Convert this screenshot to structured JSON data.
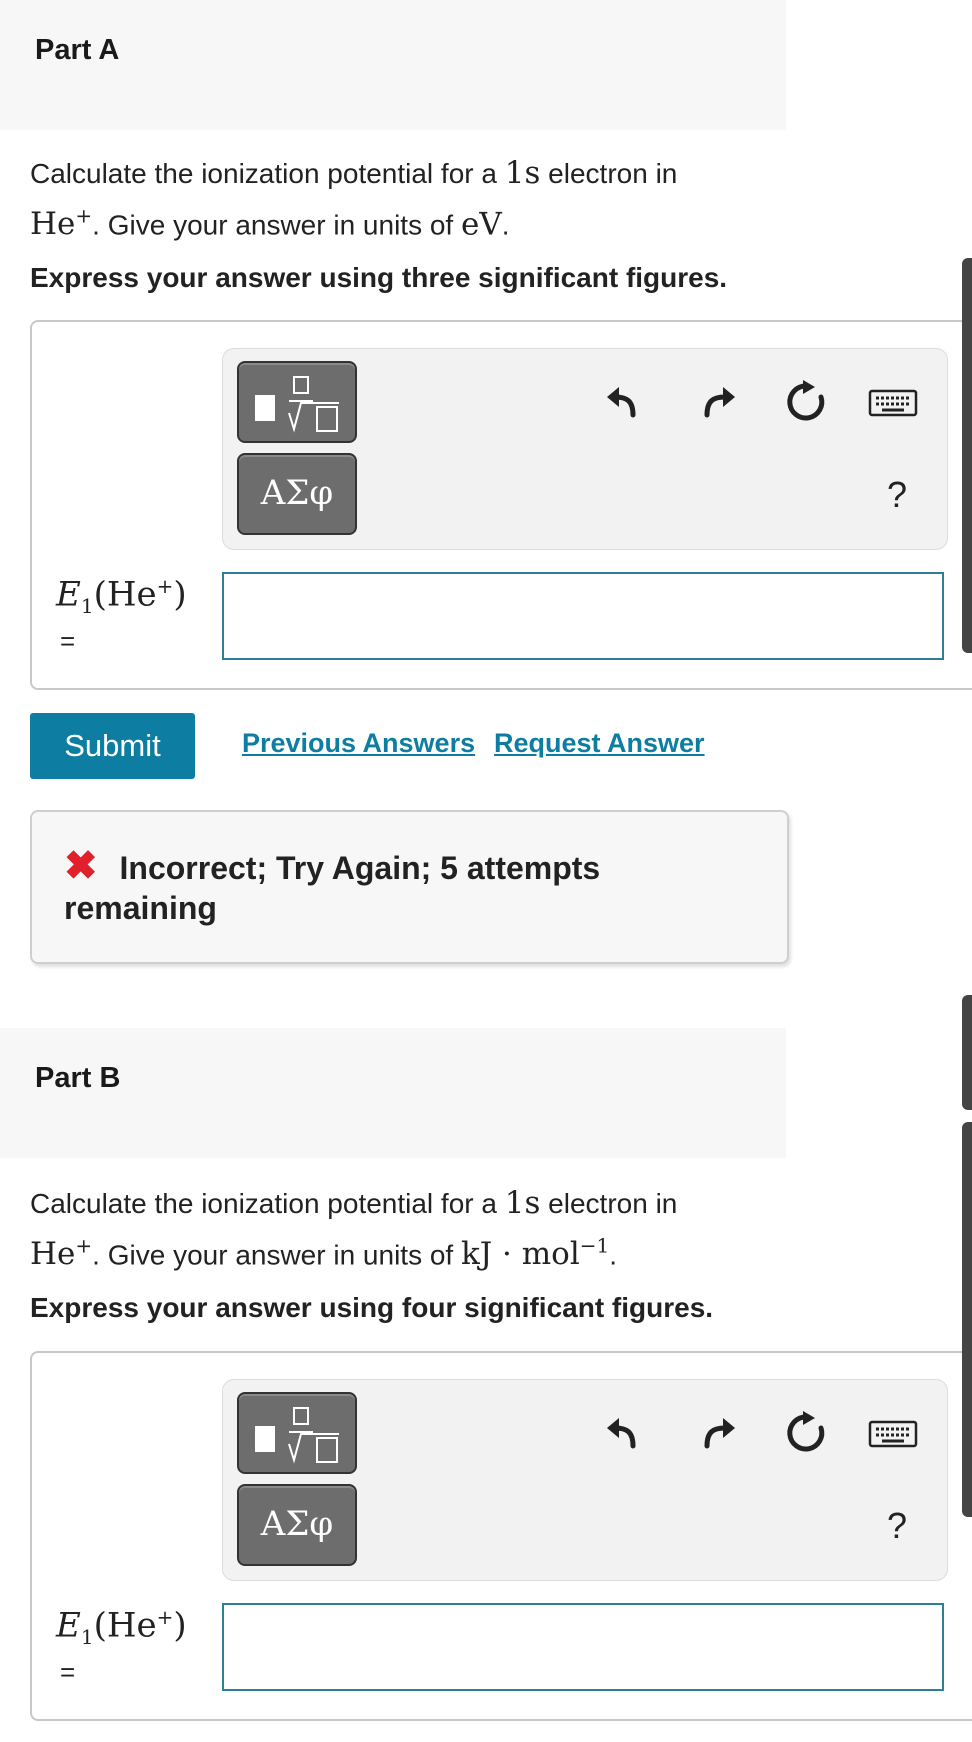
{
  "partA": {
    "title": "Part A",
    "question_pre": "Calculate the ionization potential for a ",
    "question_math1": "1s",
    "question_mid": " electron in",
    "ion": "He",
    "ion_sup": "+",
    "question_units_text": ". Give your answer in units of ",
    "units": "eV",
    "question_end": ".",
    "instruction": "Express your answer using three significant figures.",
    "label_E": "E",
    "label_sub": "1",
    "label_paren_open": "(He",
    "label_sup": "+",
    "label_paren_close": ")",
    "equals": "=",
    "input_value": "",
    "toolbar": {
      "greek_label": "ΑΣφ",
      "help_label": "?"
    }
  },
  "actions": {
    "submit_label": "Submit",
    "previous_answers_label": "Previous Answers",
    "request_answer_label": "Request Answer"
  },
  "feedback": {
    "icon": "x-mark-icon",
    "text": "Incorrect; Try Again; 5 attempts remaining",
    "icon_color": "#e0202a"
  },
  "partB": {
    "title": "Part B",
    "question_pre": "Calculate the ionization potential for a ",
    "question_math1": "1s",
    "question_mid": " electron in",
    "ion": "He",
    "ion_sup": "+",
    "question_units_text": ". Give your answer in units of ",
    "units_main": "kJ · mol",
    "units_sup": "−1",
    "question_end": ".",
    "instruction": "Express your answer using four significant figures.",
    "label_E": "E",
    "label_sub": "1",
    "label_paren_open": "(He",
    "label_sup": "+",
    "label_paren_close": ")",
    "equals": "=",
    "input_value": "",
    "toolbar": {
      "greek_label": "ΑΣφ",
      "help_label": "?"
    }
  },
  "colors": {
    "accent": "#0d7ea2",
    "input_border": "#2c7f95"
  }
}
